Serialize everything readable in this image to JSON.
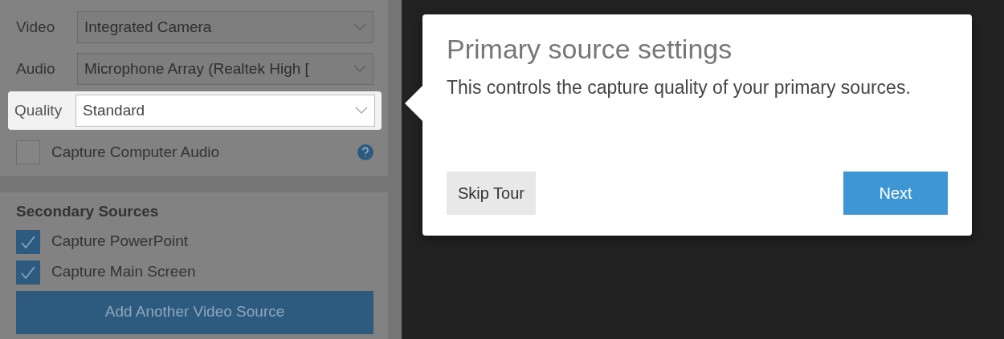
{
  "primary_sources": {
    "fields": [
      {
        "label": "Video",
        "value": "Integrated Camera",
        "highlighted": false
      },
      {
        "label": "Audio",
        "value": "Microphone Array (Realtek High [",
        "highlighted": false
      },
      {
        "label": "Quality",
        "value": "Standard",
        "highlighted": true
      }
    ],
    "capture_audio": {
      "label": "Capture Computer Audio",
      "checked": false
    }
  },
  "secondary_sources": {
    "title": "Secondary Sources",
    "options": [
      {
        "label": "Capture PowerPoint",
        "checked": true
      },
      {
        "label": "Capture Main Screen",
        "checked": true
      }
    ],
    "add_button": "Add Another Video Source"
  },
  "tour_popup": {
    "title": "Primary source settings",
    "body": "This controls the capture quality of your primary sources.",
    "skip_button": "Skip Tour",
    "next_button": "Next"
  }
}
